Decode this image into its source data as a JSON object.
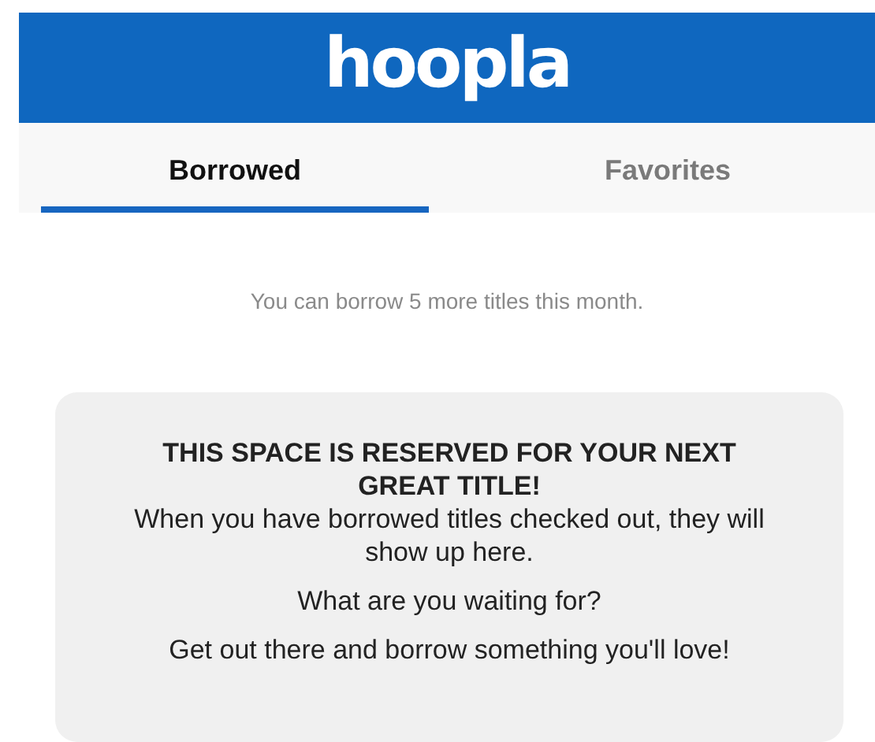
{
  "header": {
    "logo": "hoopla"
  },
  "tabs": [
    {
      "label": "Borrowed",
      "selected": true
    },
    {
      "label": "Favorites",
      "selected": false
    }
  ],
  "notice": "You can borrow 5 more titles this month.",
  "empty_state": {
    "title": "THIS SPACE IS RESERVED FOR YOUR NEXT GREAT TITLE!",
    "paragraphs": [
      "When you have borrowed titles checked out, they will show up here.",
      "What are you waiting for?",
      "Get out there and borrow something you'll love!"
    ]
  }
}
